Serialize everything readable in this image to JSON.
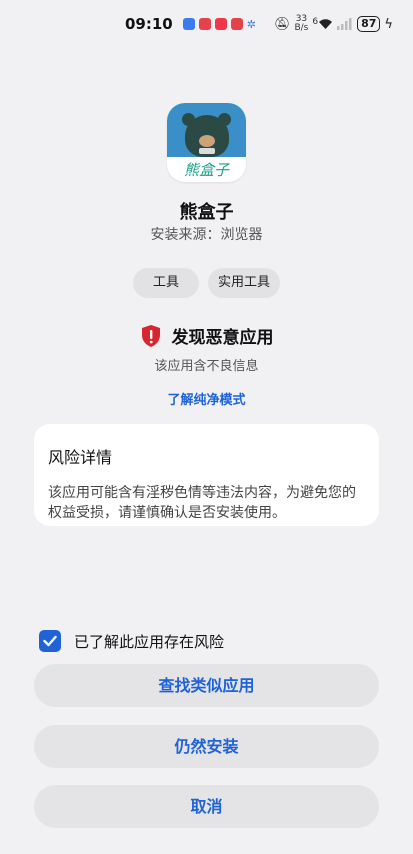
{
  "status_bar": {
    "time": "09:10",
    "network_speed_value": "33",
    "network_speed_unit": "B/s",
    "wifi_generation": "6",
    "battery": "87"
  },
  "app": {
    "icon_label": "熊盒子",
    "name": "熊盒子",
    "source": "安装来源：浏览器",
    "tags": [
      "工具",
      "实用工具"
    ]
  },
  "warning": {
    "title": "发现恶意应用",
    "subtitle": "该应用含不良信息",
    "learn_more": "了解纯净模式",
    "color": "#d6262f"
  },
  "risk_card": {
    "title": "风险详情",
    "body": "该应用可能含有淫秽色情等违法内容，为避免您的权益受损，请谨慎确认是否安装使用。"
  },
  "acknowledge": {
    "label": "已了解此应用存在风险",
    "checked": true
  },
  "buttons": {
    "find_similar": "查找类似应用",
    "install_anyway": "仍然安装",
    "cancel": "取消"
  },
  "colors": {
    "accent": "#1f63d6",
    "background": "#f1f1f3"
  }
}
